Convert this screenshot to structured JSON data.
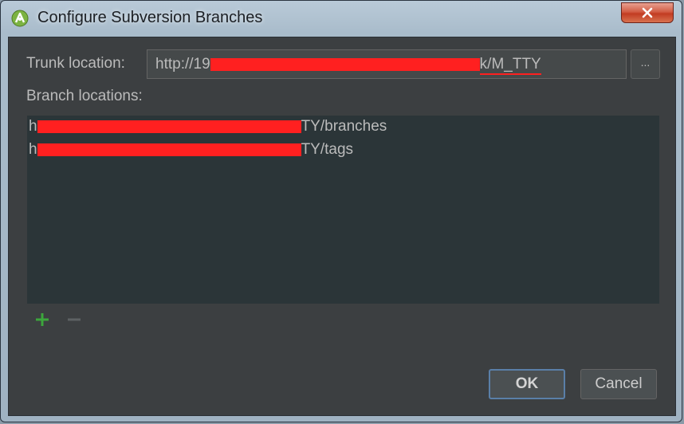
{
  "window": {
    "title": "Configure Subversion Branches"
  },
  "trunk": {
    "label": "Trunk location:",
    "value_prefix": "http://19",
    "value_suffix": "k/M_TTY",
    "browse_label": "..."
  },
  "branches": {
    "label": "Branch locations:",
    "items": [
      {
        "prefix": "h",
        "suffix": "TY/branches"
      },
      {
        "prefix": "h",
        "suffix": "TY/tags"
      }
    ]
  },
  "buttons": {
    "ok": "OK",
    "cancel": "Cancel"
  },
  "icons": {
    "app": "android-studio-icon",
    "close": "close-icon",
    "add": "plus-icon",
    "remove": "minus-icon"
  },
  "colors": {
    "accent_focus": "#5a7fa8",
    "add_green": "#3ca63c",
    "redaction": "#ff2020"
  }
}
